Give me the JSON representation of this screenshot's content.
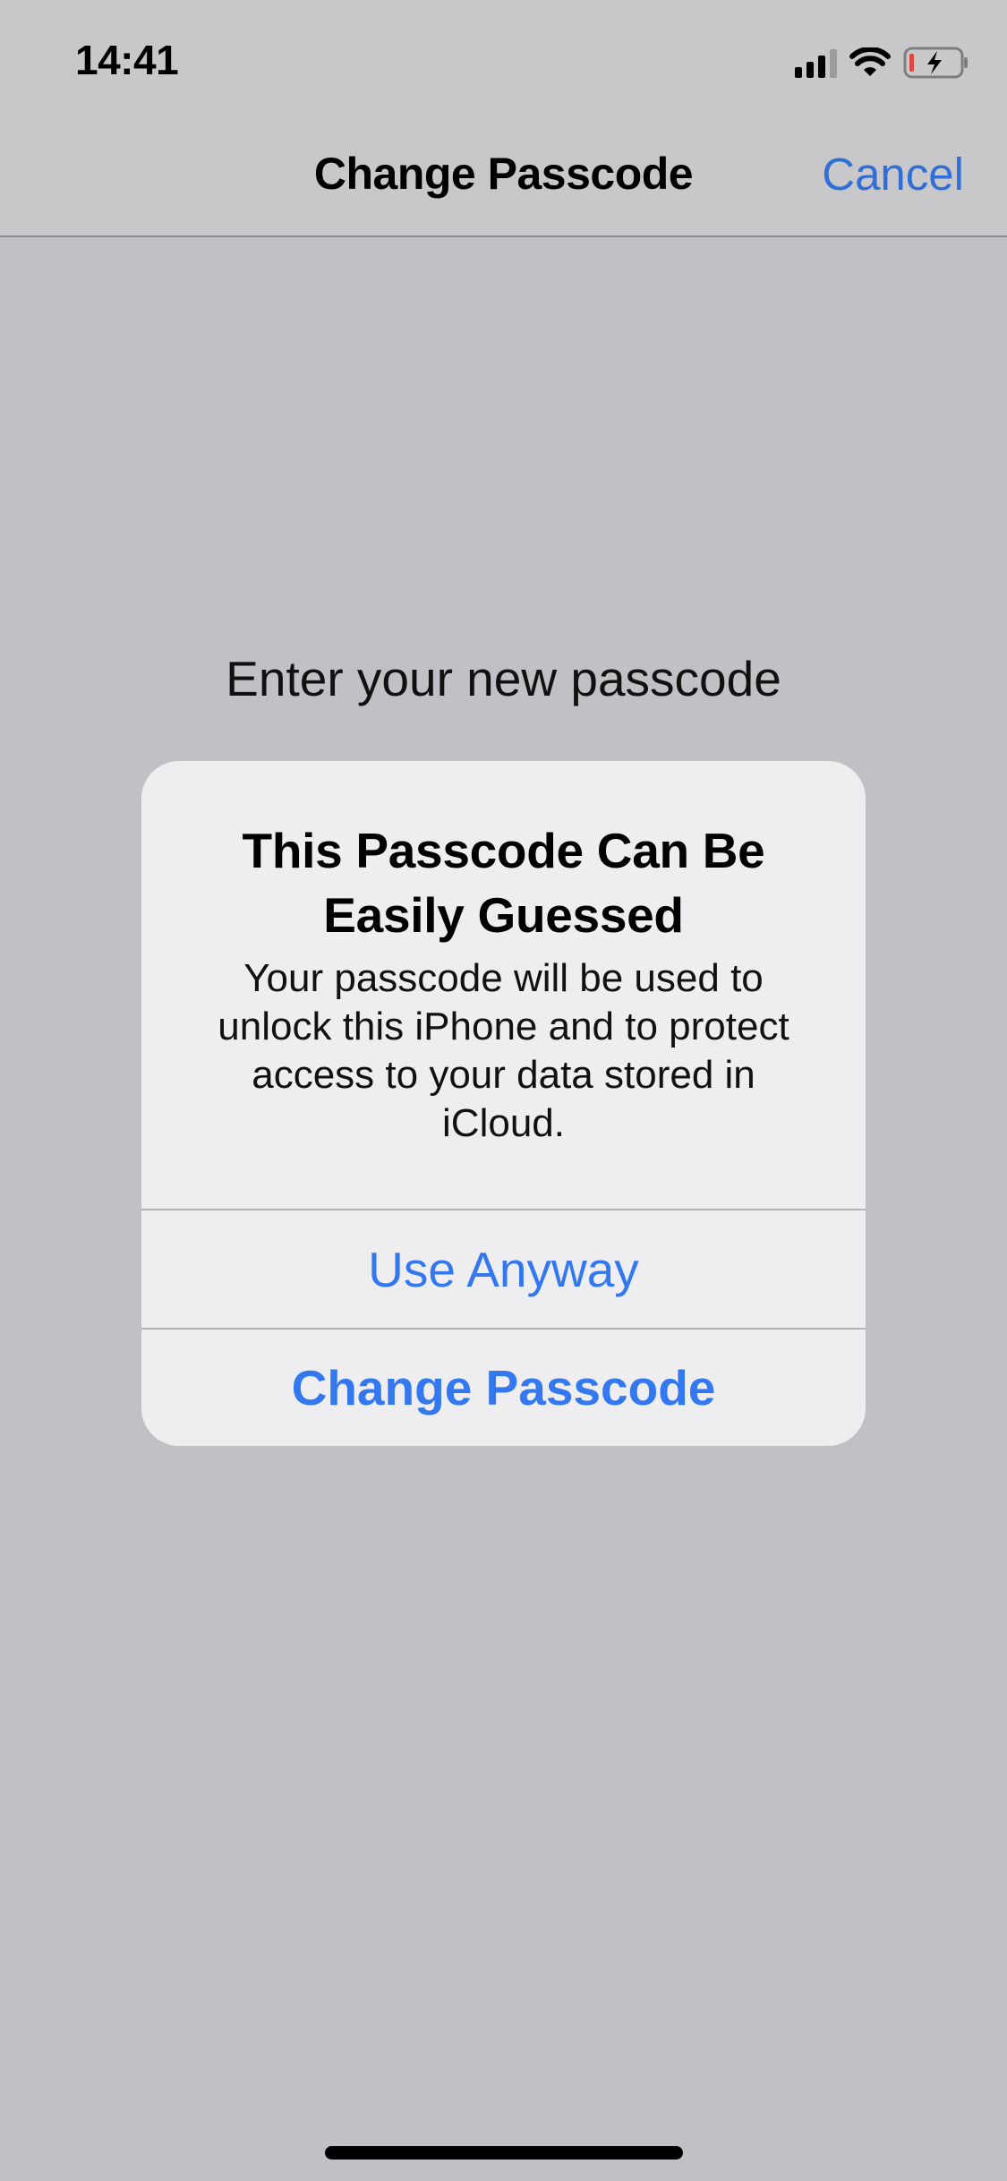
{
  "status_bar": {
    "time": "14:41",
    "signal_icon": "cellular-signal-icon",
    "signal_bars_active": 3,
    "signal_bars_total": 4,
    "wifi_icon": "wifi-icon",
    "battery_icon": "battery-charging-icon",
    "battery_level": 0.1,
    "battery_low_color": "#e0443b"
  },
  "nav": {
    "title": "Change Passcode",
    "cancel_label": "Cancel",
    "accent_color": "#2f6fd6"
  },
  "main": {
    "prompt": "Enter your new passcode"
  },
  "alert": {
    "title": "This Passcode Can Be Easily Guessed",
    "message": "Your passcode will be used to unlock this iPhone and to protect access to your data stored in iCloud.",
    "buttons": [
      {
        "label": "Use Anyway",
        "style": "default"
      },
      {
        "label": "Change Passcode",
        "style": "preferred"
      }
    ],
    "button_color": "#3478f0"
  }
}
